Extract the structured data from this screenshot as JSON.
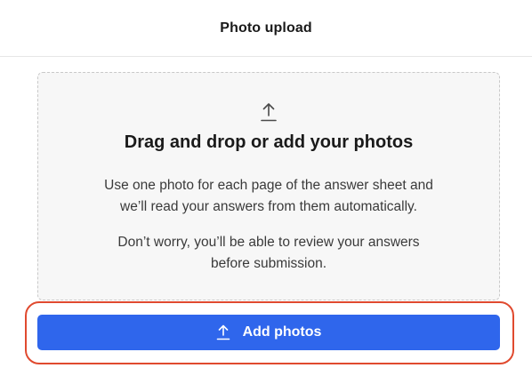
{
  "header": {
    "title": "Photo upload"
  },
  "dropzone": {
    "icon": "upload-icon",
    "title": "Drag and drop or add your photos",
    "description_line1": "Use one photo for each page of the answer sheet and",
    "description_line2": "we’ll read your answers from them automatically.",
    "note_line1": "Don’t worry, you’ll be able to review your answers",
    "note_line2": "before submission."
  },
  "add_button": {
    "icon": "upload-icon",
    "label": "Add photos"
  },
  "colors": {
    "primary": "#2f66ec",
    "highlight_outline": "#e04a2f",
    "dropzone_bg": "#f7f7f7"
  }
}
